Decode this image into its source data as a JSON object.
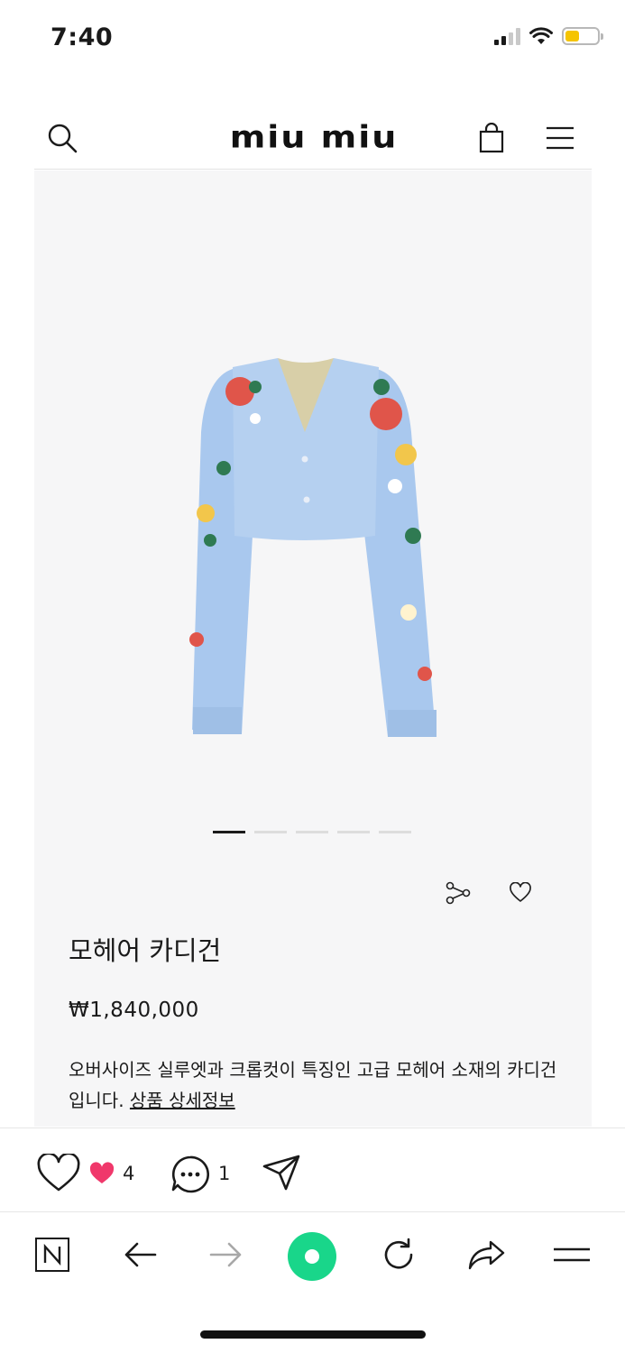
{
  "status_bar": {
    "time": "7:40",
    "battery_color": "#f5c400"
  },
  "header": {
    "logo": "miu miu",
    "search_icon": "search-icon",
    "cart_icon": "shopping-bag-icon",
    "menu_icon": "hamburger-menu-icon"
  },
  "product": {
    "title": "모헤어 카디건",
    "price": "₩1,840,000",
    "description": "오버사이즈 실루엣과 크롭컷이 특징인 고급 모헤어 소재의 카디건입니다.",
    "detail_link": "상품 상세정보",
    "image_count": 5,
    "active_image": 1,
    "background": "#f6f6f7"
  },
  "social": {
    "like_count": "4",
    "comment_count": "1",
    "heart_color": "#f0386b"
  },
  "browser": {
    "home_button_color": "#19d68a"
  }
}
